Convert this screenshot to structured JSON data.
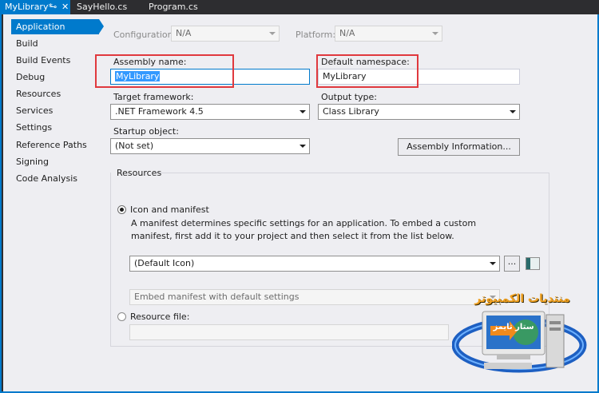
{
  "tabs": [
    {
      "label": "MyLibrary*",
      "active": true
    },
    {
      "label": "SayHello.cs",
      "active": false
    },
    {
      "label": "Program.cs",
      "active": false
    }
  ],
  "tab_icons": {
    "pin": "pin-icon",
    "close": "close-icon"
  },
  "nav": {
    "items": [
      {
        "label": "Application",
        "active": true
      },
      {
        "label": "Build"
      },
      {
        "label": "Build Events"
      },
      {
        "label": "Debug"
      },
      {
        "label": "Resources"
      },
      {
        "label": "Services"
      },
      {
        "label": "Settings"
      },
      {
        "label": "Reference Paths"
      },
      {
        "label": "Signing"
      },
      {
        "label": "Code Analysis"
      }
    ]
  },
  "config": {
    "configuration_label": "Configuration:",
    "configuration_value": "N/A",
    "platform_label": "Platform:",
    "platform_value": "N/A"
  },
  "form": {
    "assembly_name_label": "Assembly name:",
    "assembly_name_value": "MyLibrary",
    "default_namespace_label": "Default namespace:",
    "default_namespace_value": "MyLibrary",
    "target_framework_label": "Target framework:",
    "target_framework_value": ".NET Framework 4.5",
    "output_type_label": "Output type:",
    "output_type_value": "Class Library",
    "startup_object_label": "Startup object:",
    "startup_object_value": "(Not set)",
    "assembly_info_button": "Assembly Information..."
  },
  "resources": {
    "group_label": "Resources",
    "icon_manifest_label": "Icon and manifest",
    "icon_manifest_selected": true,
    "description": "A manifest determines specific settings for an application. To embed a custom manifest, first add it to your project and then select it from the list below.",
    "icon_value": "(Default Icon)",
    "browse_button": "...",
    "manifest_value": "Embed manifest with default settings",
    "resource_file_label": "Resource file:",
    "resource_file_value": ""
  },
  "watermark": {
    "arabic_title": "منتديات الكمبيوتر",
    "screen_text": "ستار تايمز"
  },
  "colors": {
    "accent": "#007acc",
    "highlight": "#e0393e",
    "selection": "#3399ff"
  }
}
